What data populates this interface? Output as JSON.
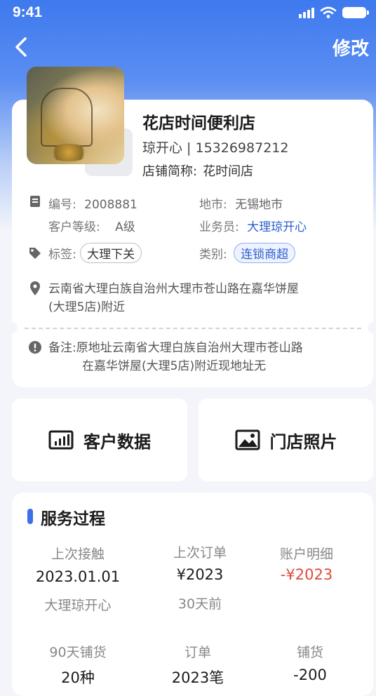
{
  "status_bar": {
    "time": "9:41"
  },
  "nav": {
    "edit_label": "修改"
  },
  "store": {
    "name": "花店时间便利店",
    "contact": "琼开心 | 15326987212",
    "short_name_label": "店铺简称:",
    "short_name": "花时间店"
  },
  "info": {
    "code_label": "编号:",
    "code": "2008881",
    "city_label": "地市:",
    "city": "无锡地市",
    "level_label": "客户等级:",
    "level": "A级",
    "sales_label": "业务员:",
    "sales": "大理琼开心",
    "tag_label": "标签:",
    "tag": "大理下关",
    "category_label": "类别:",
    "category": "连锁商超",
    "address_line1": "云南省大理白族自治州大理市苍山路在嘉华饼屋",
    "address_line2": "(大理5店)附近",
    "note_line1": "备注:原地址云南省大理白族自治州大理市苍山路",
    "note_line2": "在嘉华饼屋(大理5店)附近现地址无"
  },
  "tiles": {
    "customer_data": "客户数据",
    "store_photos": "门店照片"
  },
  "service": {
    "title": "服务过程",
    "last_contact_label": "上次接触",
    "last_contact_date": "2023.01.01",
    "last_contact_person": "大理琼开心",
    "last_order_label": "上次订单",
    "last_order_amount": "¥2023",
    "last_order_ago": "30天前",
    "account_label": "账户明细",
    "account_amount": "-¥2023",
    "stock90_label": "90天铺货",
    "stock90_value": "20种",
    "orders_label": "订单",
    "orders_value": "2023笔",
    "stock_label": "铺货",
    "stock_value": "-200"
  },
  "colors": {
    "accent": "#3d6fea",
    "negative": "#e04a3c"
  }
}
